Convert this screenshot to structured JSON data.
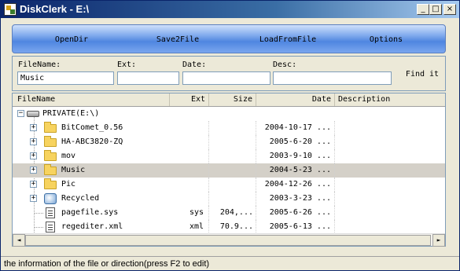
{
  "window": {
    "title": "DiskClerk - E:\\"
  },
  "toolbar": {
    "open_dir": "OpenDir",
    "save2file": "Save2File",
    "load_from_file": "LoadFromFile",
    "options": "Options"
  },
  "search": {
    "file_name_label": "FileName:",
    "file_name_value": "Music",
    "ext_label": "Ext:",
    "ext_value": "",
    "date_label": "Date:",
    "date_value": "",
    "desc_label": "Desc:",
    "desc_value": "",
    "find_label": "Find it"
  },
  "columns": {
    "file_name": "FileName",
    "ext": "Ext",
    "size": "Size",
    "date": "Date",
    "description": "Description"
  },
  "tree": {
    "root": "PRIVATE(E:\\)",
    "rows": [
      {
        "name": "BitComet_0.56",
        "ext": "",
        "size": "",
        "date": "2004-10-17 ...",
        "icon": "folder-icon",
        "expandable": true
      },
      {
        "name": "HA-ABC3820-ZQ",
        "ext": "",
        "size": "",
        "date": "2005-6-20 ...",
        "icon": "folder-icon",
        "expandable": true
      },
      {
        "name": "mov",
        "ext": "",
        "size": "",
        "date": "2003-9-10 ...",
        "icon": "folder-icon",
        "expandable": true
      },
      {
        "name": "Music",
        "ext": "",
        "size": "",
        "date": "2004-5-23 ...",
        "icon": "folder-icon",
        "expandable": true,
        "selected": true
      },
      {
        "name": "Pic",
        "ext": "",
        "size": "",
        "date": "2004-12-26 ...",
        "icon": "folder-icon",
        "expandable": true
      },
      {
        "name": "Recycled",
        "ext": "",
        "size": "",
        "date": "2003-3-23 ...",
        "icon": "recycle-bin-icon",
        "expandable": true
      },
      {
        "name": "pagefile.sys",
        "ext": "sys",
        "size": "204,...",
        "date": "2005-6-26 ...",
        "icon": "system-file-icon",
        "expandable": false
      },
      {
        "name": "regediter.xml",
        "ext": "xml",
        "size": "70.9...",
        "date": "2005-6-13 ...",
        "icon": "document-file-icon",
        "expandable": false
      }
    ]
  },
  "status": {
    "text": "the information of the file or direction(press F2 to edit)"
  }
}
